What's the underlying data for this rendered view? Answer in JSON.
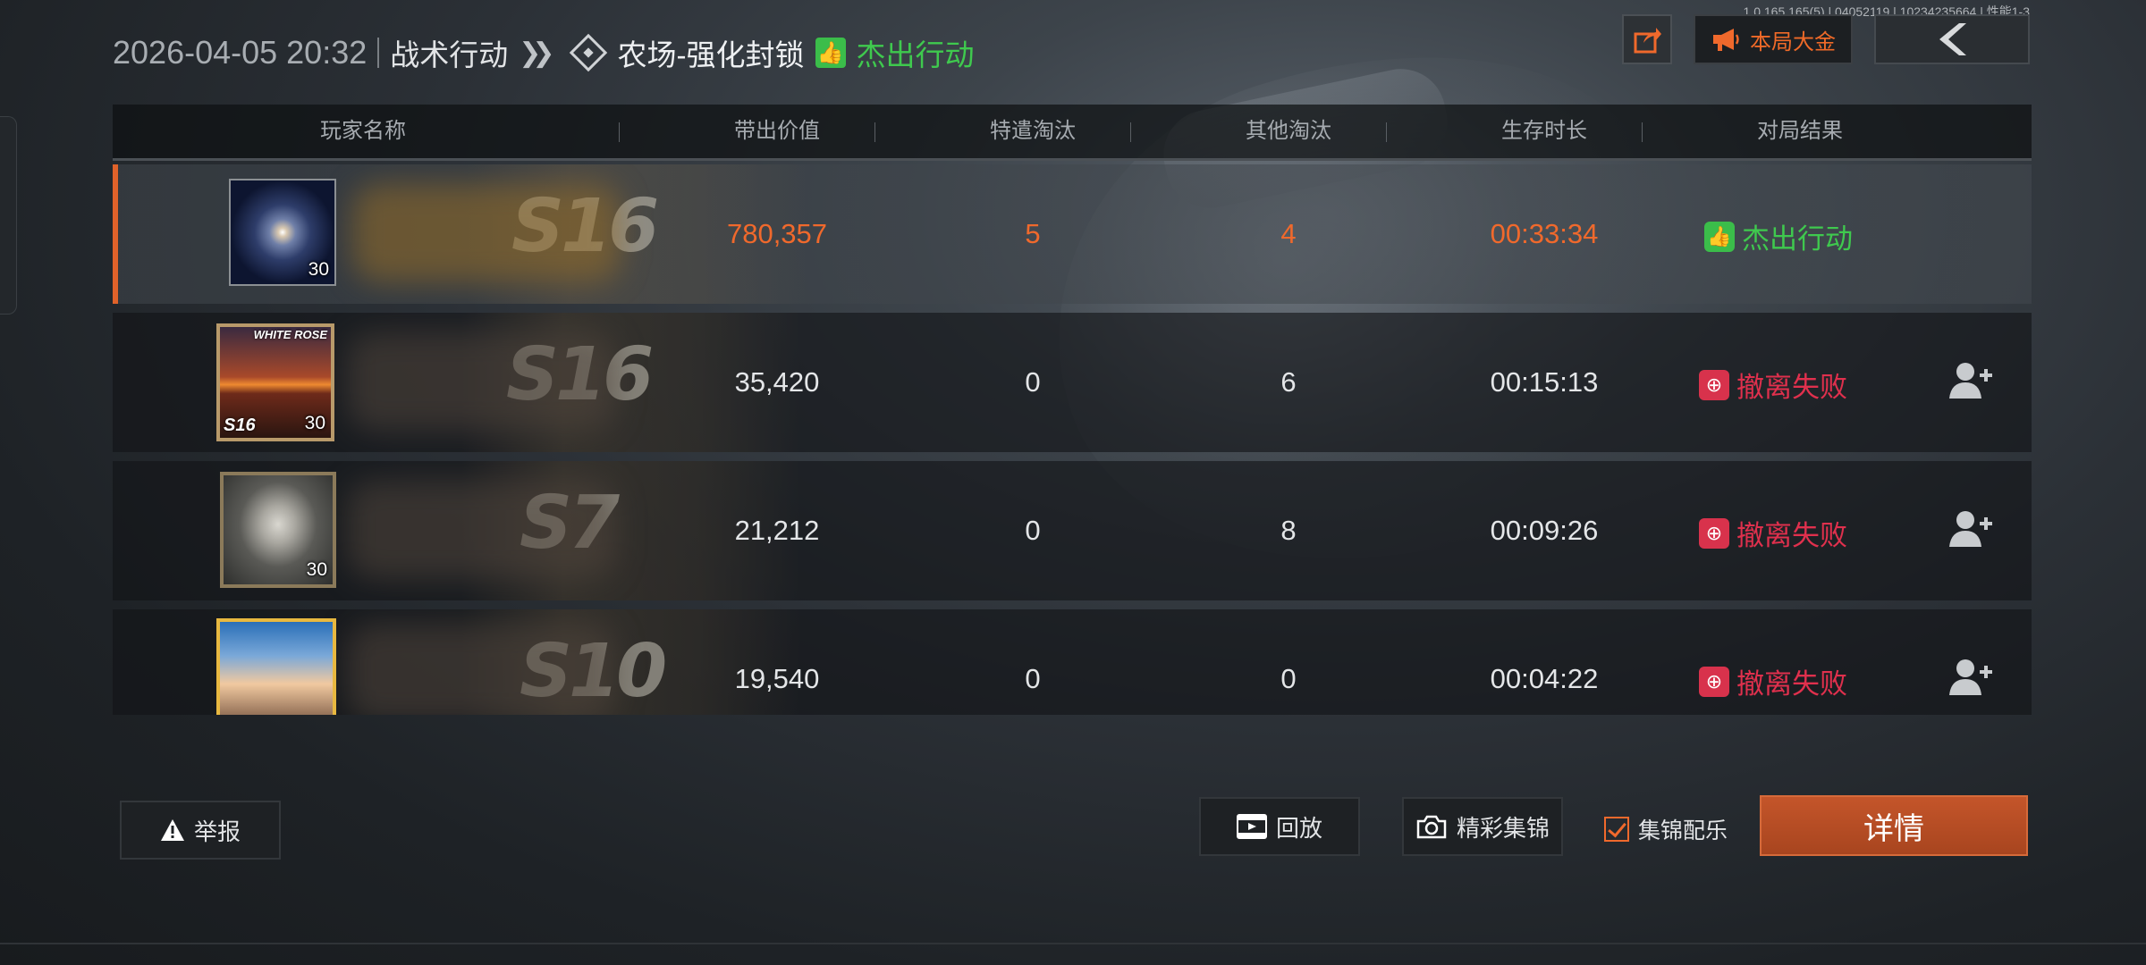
{
  "build_info": "1.0.165.165(5) | 04052119 | 10234235664 | 性能1-3",
  "header": {
    "datetime": "2026-04-05 20:32",
    "mode": "战术行动",
    "map": "农场-强化封锁",
    "result": "杰出行动",
    "result_badge": "👍"
  },
  "top_right": {
    "share_icon": "share-icon",
    "gold_label": "本局大金",
    "gold_icon": "megaphone-icon",
    "back_icon": "back-arrow-icon"
  },
  "table": {
    "columns": [
      "玩家名称",
      "带出价值",
      "特遣淘汰",
      "其他淘汰",
      "生存时长",
      "对局结果"
    ],
    "rows": [
      {
        "level": "30",
        "season": "S16",
        "value": "780,357",
        "special": "5",
        "other": "4",
        "time": "00:33:34",
        "result": "杰出行动",
        "result_type": "good"
      },
      {
        "level": "30",
        "season": "S16",
        "value": "35,420",
        "special": "0",
        "other": "6",
        "time": "00:15:13",
        "result": "撤离失败",
        "result_type": "bad",
        "avatar_tag": "S16",
        "avatar_brand": "WHITE ROSE"
      },
      {
        "level": "30",
        "season": "S7",
        "value": "21,212",
        "special": "0",
        "other": "8",
        "time": "00:09:26",
        "result": "撤离失败",
        "result_type": "bad"
      },
      {
        "level": "",
        "season": "S10",
        "value": "19,540",
        "special": "0",
        "other": "0",
        "time": "00:04:22",
        "result": "撤离失败",
        "result_type": "bad"
      }
    ]
  },
  "bottom": {
    "report_label": "举报",
    "replay_label": "回放",
    "highlights_label": "精彩集锦",
    "bgm_label": "集锦配乐",
    "bgm_checked": true,
    "details_label": "详情"
  },
  "colors": {
    "accent_orange": "#f0692c",
    "success_green": "#3fc94e",
    "fail_red": "#e0304d"
  }
}
